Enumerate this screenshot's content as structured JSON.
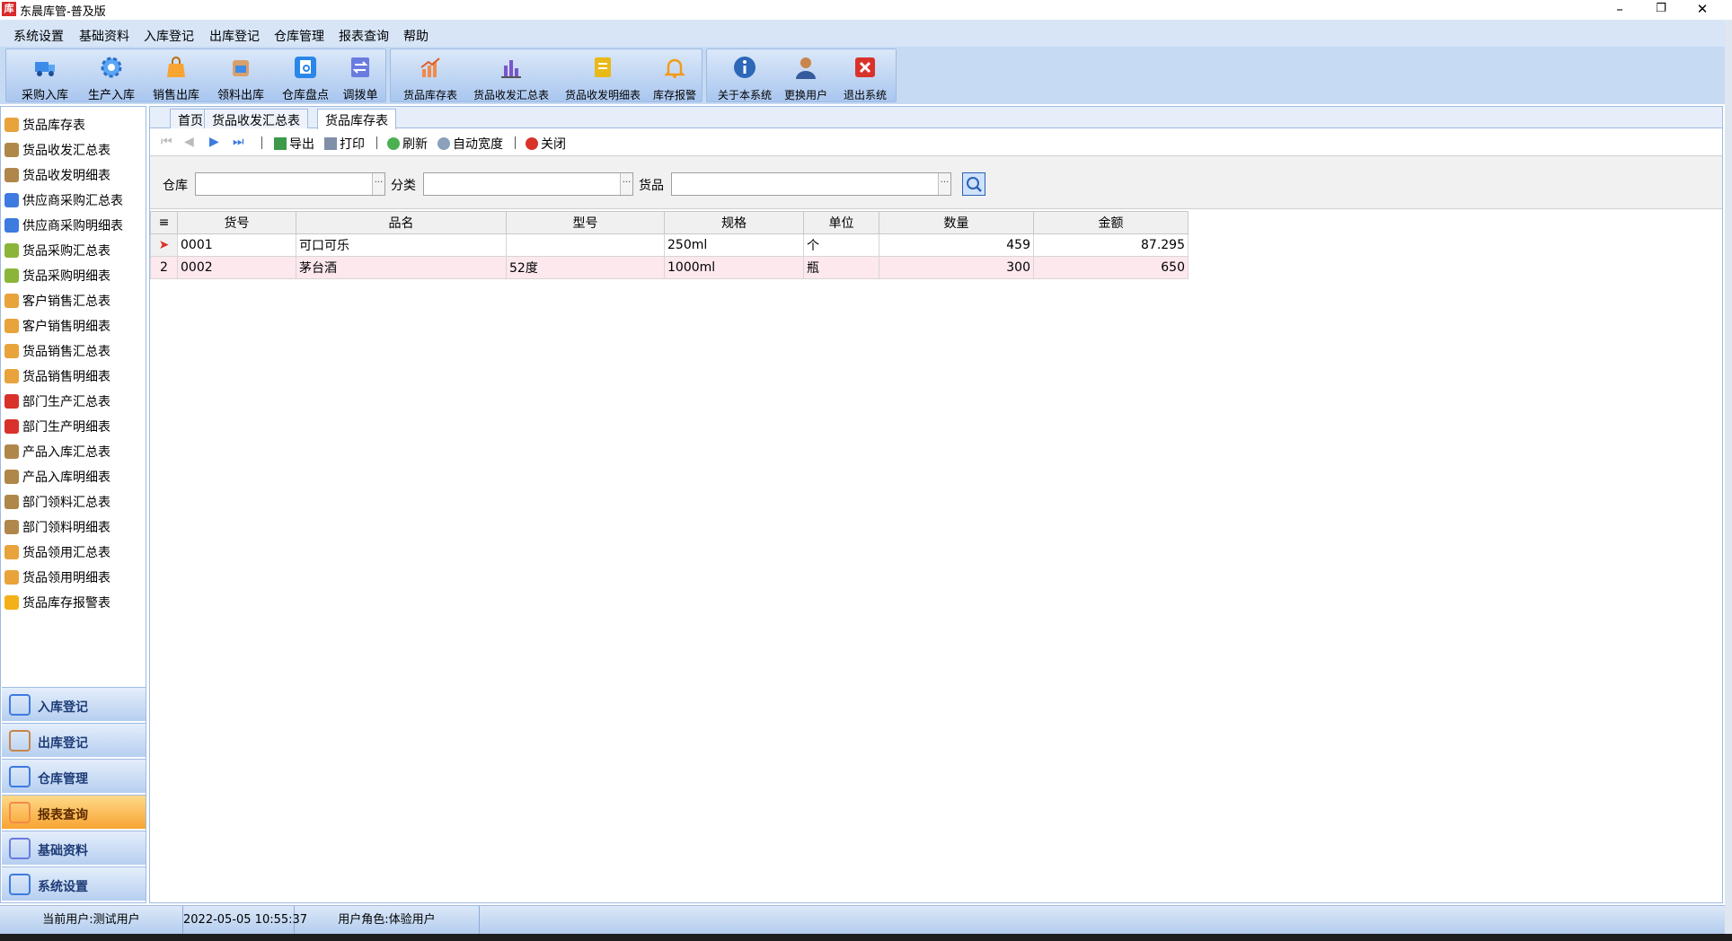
{
  "window": {
    "title": "东晨库管-普及版",
    "minimize": "–",
    "restore": "❐",
    "close": "✕"
  },
  "menu": [
    "系统设置",
    "基础资料",
    "入库登记",
    "出库登记",
    "仓库管理",
    "报表查询",
    "帮助"
  ],
  "toolbar": {
    "group1": [
      {
        "label": "采购入库",
        "icon": "truck-icon"
      },
      {
        "label": "生产入库",
        "icon": "gear-icon"
      },
      {
        "label": "销售出库",
        "icon": "bag-icon"
      },
      {
        "label": "领料出库",
        "icon": "box-icon"
      },
      {
        "label": "仓库盘点",
        "icon": "inventory-icon"
      },
      {
        "label": "调拨单",
        "icon": "transfer-icon"
      }
    ],
    "group2": [
      {
        "label": "货品库存表",
        "icon": "chart-icon"
      },
      {
        "label": "货品收发汇总表",
        "icon": "bar-chart-icon"
      },
      {
        "label": "货品收发明细表",
        "icon": "document-icon"
      },
      {
        "label": "库存报警",
        "icon": "bell-icon"
      }
    ],
    "group3": [
      {
        "label": "关于本系统",
        "icon": "info-icon"
      },
      {
        "label": "更换用户",
        "icon": "user-icon"
      },
      {
        "label": "退出系统",
        "icon": "exit-icon"
      }
    ]
  },
  "sidebar": {
    "items": [
      "货品库存表",
      "货品收发汇总表",
      "货品收发明细表",
      "供应商采购汇总表",
      "供应商采购明细表",
      "货品采购汇总表",
      "货品采购明细表",
      "客户销售汇总表",
      "客户销售明细表",
      "货品销售汇总表",
      "货品销售明细表",
      "部门生产汇总表",
      "部门生产明细表",
      "产品入库汇总表",
      "产品入库明细表",
      "部门领料汇总表",
      "部门领料明细表",
      "货品领用汇总表",
      "货品领用明细表",
      "货品库存报警表"
    ],
    "sections": [
      "入库登记",
      "出库登记",
      "仓库管理",
      "报表查询",
      "基础资料",
      "系统设置"
    ],
    "active_section": "报表查询"
  },
  "tabs": [
    "首页",
    "货品收发汇总表",
    "货品库存表"
  ],
  "active_tab": "货品库存表",
  "gridbar": {
    "export": "导出",
    "print": "打印",
    "refresh": "刷新",
    "autowidth": "自动宽度",
    "close": "关闭"
  },
  "filters": {
    "warehouse_label": "仓库",
    "category_label": "分类",
    "goods_label": "货品",
    "warehouse_value": "",
    "category_value": "",
    "goods_value": "",
    "dropdown_glyph": "···"
  },
  "table": {
    "corner": "≡",
    "columns": [
      "货号",
      "品名",
      "型号",
      "规格",
      "单位",
      "数量",
      "金额"
    ],
    "rows": [
      {
        "indicator": "➤",
        "code": "0001",
        "name": "可口可乐",
        "model": "",
        "spec": "250ml",
        "unit": "个",
        "qty": "459",
        "amount": "87.295"
      },
      {
        "indicator": "2",
        "code": "0002",
        "name": "茅台酒",
        "model": "52度",
        "spec": "1000ml",
        "unit": "瓶",
        "qty": "300",
        "amount": "650"
      }
    ]
  },
  "status": {
    "user": "当前用户:测试用户",
    "datetime": "2022-05-05 10:55:37",
    "role": "用户角色:体验用户"
  }
}
